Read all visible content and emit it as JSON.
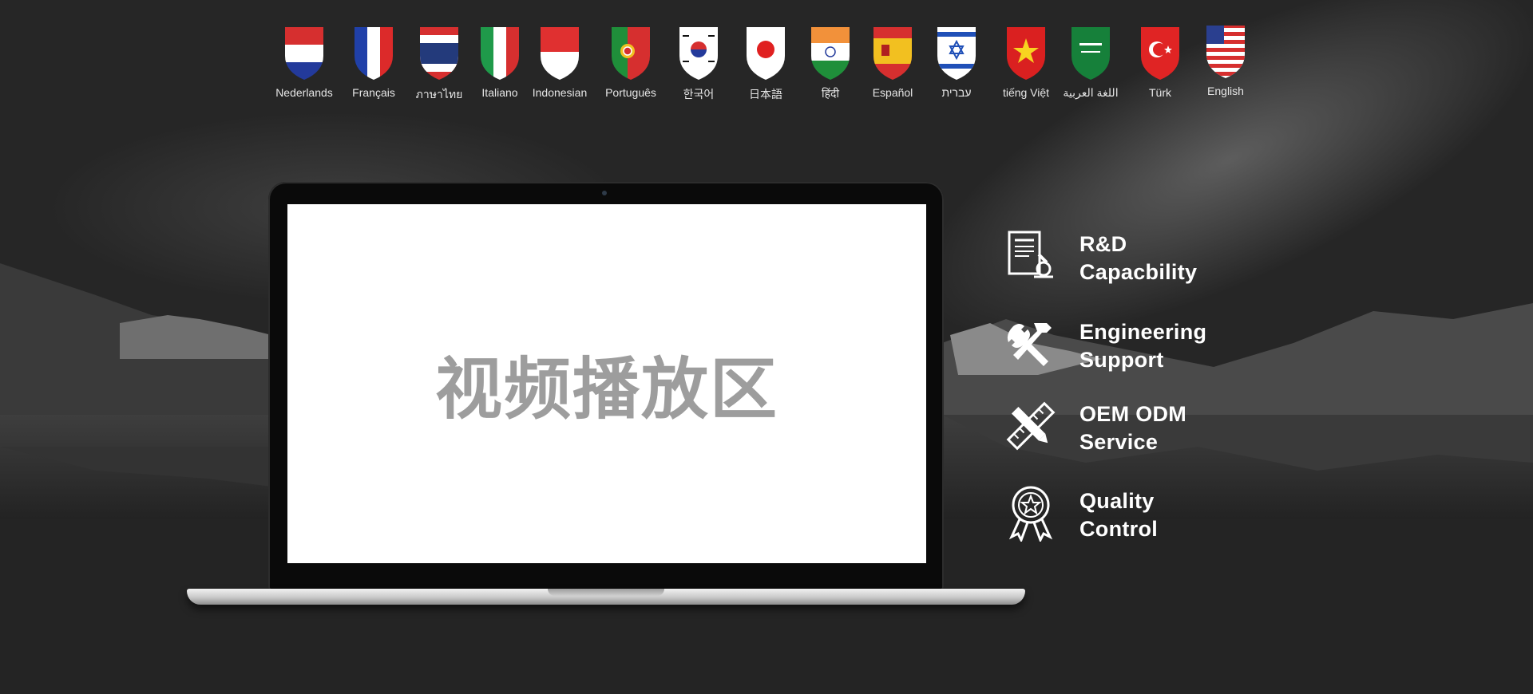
{
  "languages": [
    {
      "label": "Nederlands",
      "flag": "netherlands-flag-icon"
    },
    {
      "label": "Français",
      "flag": "france-flag-icon"
    },
    {
      "label": "ภาษาไทย",
      "flag": "thailand-flag-icon"
    },
    {
      "label": "Italiano",
      "flag": "italy-flag-icon"
    },
    {
      "label": "Indonesian",
      "flag": "indonesia-flag-icon"
    },
    {
      "label": "Português",
      "flag": "portugal-flag-icon"
    },
    {
      "label": "한국어",
      "flag": "korea-flag-icon"
    },
    {
      "label": "日本語",
      "flag": "japan-flag-icon"
    },
    {
      "label": "हिंदी",
      "flag": "india-flag-icon"
    },
    {
      "label": "Español",
      "flag": "spain-flag-icon"
    },
    {
      "label": "עברית",
      "flag": "israel-flag-icon"
    },
    {
      "label": "tiếng Việt",
      "flag": "vietnam-flag-icon"
    },
    {
      "label": "اللغة العربية",
      "flag": "saudi-arabia-flag-icon"
    },
    {
      "label": "Türk",
      "flag": "turkey-flag-icon"
    },
    {
      "label": "English",
      "flag": "usa-flag-icon"
    }
  ],
  "video": {
    "placeholder": "视频播放区"
  },
  "features": [
    {
      "line1": "R&D",
      "line2": "Capacbility",
      "icon": "document-microscope-icon"
    },
    {
      "line1": "Engineering",
      "line2": "Support",
      "icon": "wrench-hammer-icon"
    },
    {
      "line1": "OEM ODM",
      "line2": "Service",
      "icon": "ruler-pencil-icon"
    },
    {
      "line1": "Quality",
      "line2": "Control",
      "icon": "award-ribbon-icon"
    }
  ],
  "colors": {
    "background": "#262626",
    "text": "#ffffff",
    "screen": "#ffffff",
    "placeholder": "#9d9d9d"
  }
}
